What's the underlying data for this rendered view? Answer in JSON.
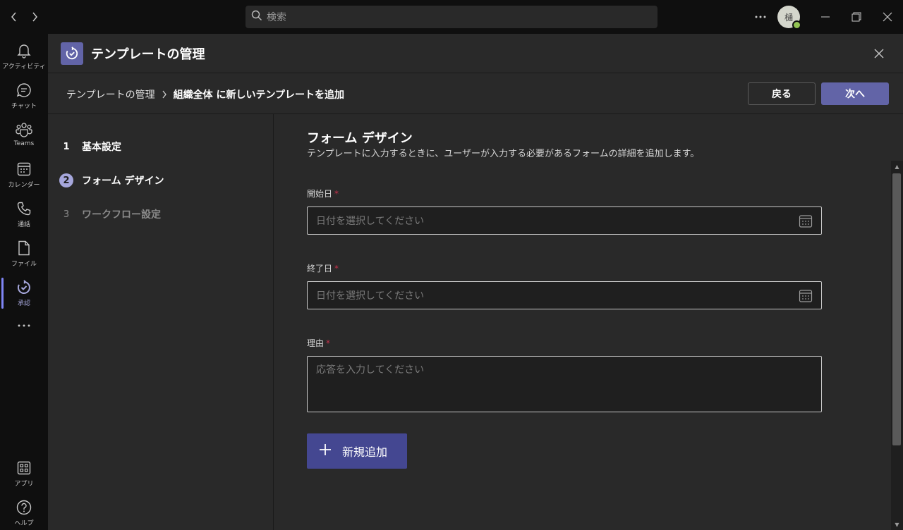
{
  "titlebar": {
    "search_placeholder": "検索",
    "avatar_initial": "樋",
    "presence_color": "#92c353"
  },
  "rail": {
    "items": [
      {
        "label": "アクティビティ",
        "icon": "bell-icon"
      },
      {
        "label": "チャット",
        "icon": "chat-icon"
      },
      {
        "label": "Teams",
        "icon": "teams-icon"
      },
      {
        "label": "カレンダー",
        "icon": "calendar-icon"
      },
      {
        "label": "通話",
        "icon": "phone-icon"
      },
      {
        "label": "ファイル",
        "icon": "file-icon"
      },
      {
        "label": "承認",
        "icon": "approvals-icon",
        "active": true
      }
    ],
    "bottom": [
      {
        "label": "アプリ",
        "icon": "apps-icon"
      },
      {
        "label": "ヘルプ",
        "icon": "help-icon"
      }
    ]
  },
  "panel": {
    "title": "テンプレートの管理",
    "breadcrumb": {
      "root": "テンプレートの管理",
      "current": "組織全体 に新しいテンプレートを追加"
    },
    "back_label": "戻る",
    "next_label": "次へ"
  },
  "steps": [
    {
      "number": "1",
      "label": "基本設定",
      "state": "done"
    },
    {
      "number": "2",
      "label": "フォーム デザイン",
      "state": "active"
    },
    {
      "number": "3",
      "label": "ワークフロー設定",
      "state": "pending"
    }
  ],
  "form": {
    "title": "フォーム デザイン",
    "description": "テンプレートに入力するときに、ユーザーが入力する必要があるフォームの詳細を追加します。",
    "fields": [
      {
        "label": "開始日",
        "required_mark": "*",
        "placeholder": "日付を選択してください"
      },
      {
        "label": "終了日",
        "required_mark": "*",
        "placeholder": "日付を選択してください"
      },
      {
        "label": "理由",
        "required_mark": "*",
        "placeholder": "応答を入力してください"
      }
    ],
    "add_label": "新規追加"
  },
  "colors": {
    "accent": "#6264a7",
    "accent_dark": "#444791",
    "required": "#c4314b"
  }
}
